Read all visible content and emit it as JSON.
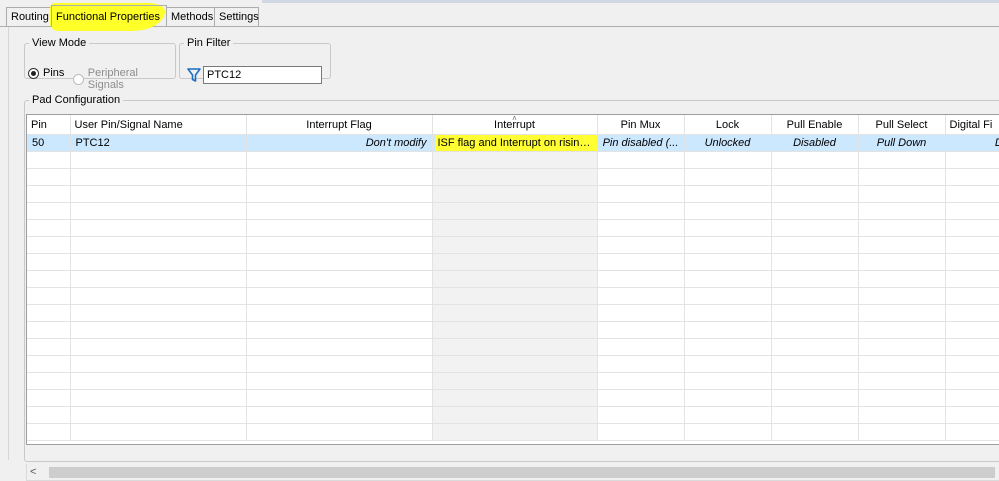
{
  "tabs": [
    {
      "label": "Routing",
      "active": false
    },
    {
      "label": "Functional Properties",
      "active": true,
      "highlighted": true
    },
    {
      "label": "Methods",
      "active": false
    },
    {
      "label": "Settings",
      "active": false
    }
  ],
  "view_mode": {
    "legend": "View Mode",
    "options": [
      {
        "label": "Pins",
        "selected": true,
        "enabled": true
      },
      {
        "label": "Peripheral Signals",
        "selected": false,
        "enabled": false
      }
    ]
  },
  "pin_filter": {
    "legend": "Pin Filter",
    "value": "PTC12",
    "icon": "filter-icon"
  },
  "pad_configuration": {
    "legend": "Pad Configuration",
    "columns": [
      "Pin",
      "User Pin/Signal Name",
      "Interrupt Flag",
      "Interrupt",
      "Pin Mux",
      "Lock",
      "Pull Enable",
      "Pull Select",
      "Digital Fi"
    ],
    "sorted_column": "Interrupt",
    "rows": [
      {
        "pin": "50",
        "name": "PTC12",
        "interrupt_flag": "Don't modify",
        "interrupt": "ISF flag and Interrupt on rising-...",
        "pin_mux": "Pin disabled (...",
        "lock": "Unlocked",
        "pull_enable": "Disabled",
        "pull_select": "Pull Down",
        "digital_filter": "Disable"
      }
    ]
  },
  "colors": {
    "highlight": "#ffff00",
    "selected_row": "#cce8ff",
    "background": "#f0f0f0"
  }
}
